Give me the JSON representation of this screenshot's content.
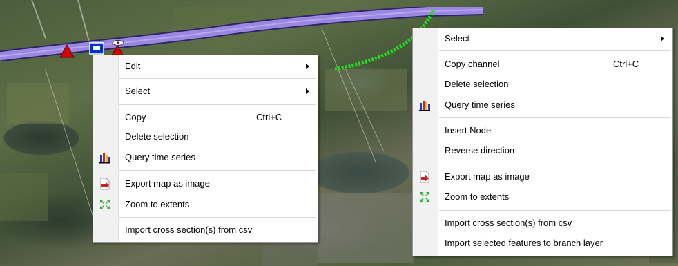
{
  "menu_left": {
    "items": [
      {
        "label": "Edit",
        "submenu": true
      },
      {
        "label": "Select",
        "submenu": true
      },
      {
        "label": "Copy",
        "shortcut": "Ctrl+C"
      },
      {
        "label": "Delete selection"
      },
      {
        "label": "Query time series",
        "icon": "bar-chart-icon"
      },
      {
        "label": "Export map as image",
        "icon": "export-image-icon"
      },
      {
        "label": "Zoom to extents",
        "icon": "zoom-extents-icon"
      },
      {
        "label": "Import cross section(s) from csv"
      }
    ]
  },
  "menu_right": {
    "items": [
      {
        "label": "Select",
        "submenu": true
      },
      {
        "label": "Copy channel",
        "shortcut": "Ctrl+C"
      },
      {
        "label": "Delete selection"
      },
      {
        "label": "Query time series",
        "icon": "bar-chart-icon"
      },
      {
        "label": "Insert Node"
      },
      {
        "label": "Reverse direction"
      },
      {
        "label": "Export map as image",
        "icon": "export-image-icon"
      },
      {
        "label": "Zoom to extents",
        "icon": "zoom-extents-icon"
      },
      {
        "label": "Import cross section(s) from csv"
      },
      {
        "label": "Import selected features to branch layer"
      }
    ]
  },
  "colors": {
    "channel": "#9a88e0",
    "selected_branch": "#22dd22",
    "node_marker": "#d80000"
  }
}
